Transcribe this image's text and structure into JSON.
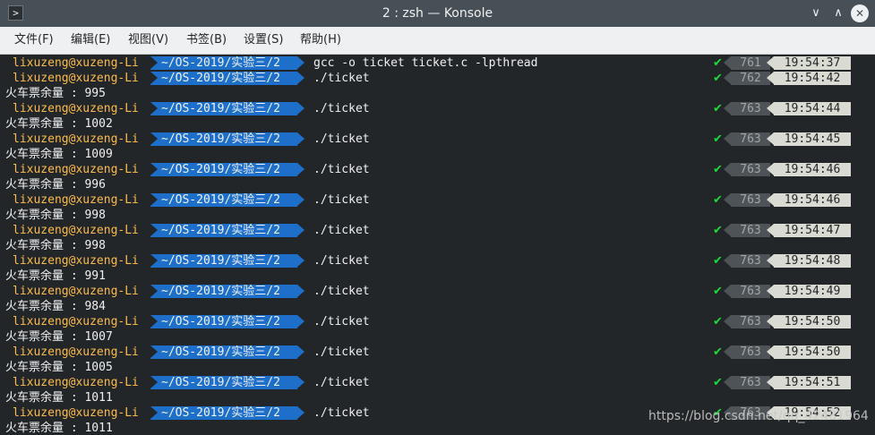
{
  "window": {
    "title": "2 : zsh — Konsole",
    "app_icon": "terminal-icon",
    "buttons": {
      "minimize": "∨",
      "maximize": "∧",
      "close": "✕"
    }
  },
  "menu": [
    {
      "label": "文件(F)"
    },
    {
      "label": "编辑(E)"
    },
    {
      "label": "视图(V)"
    },
    {
      "label": "书签(B)"
    },
    {
      "label": "设置(S)"
    },
    {
      "label": "帮助(H)"
    }
  ],
  "colors": {
    "user": "#fdbc4b",
    "path_segment": "#1d6fca",
    "success_check": "#1cdc3c",
    "history_segment": "#4d5357",
    "time_segment": "#d9dbd2",
    "terminal_bg": "#232629"
  },
  "terminal": {
    "user_host": "lixuzeng@xuzeng-Li",
    "path": "~/OS-2019/实验三/2",
    "status_icon": "✔",
    "prompts": [
      {
        "cmd": "gcc -o ticket ticket.c -lpthread",
        "hist": "761",
        "time": "19:54:37",
        "output": ""
      },
      {
        "cmd": "./ticket",
        "hist": "762",
        "time": "19:54:42",
        "output": "火车票余量 : 995"
      },
      {
        "cmd": "./ticket",
        "hist": "763",
        "time": "19:54:44",
        "output": "火车票余量 : 1002"
      },
      {
        "cmd": "./ticket",
        "hist": "763",
        "time": "19:54:45",
        "output": "火车票余量 : 1009"
      },
      {
        "cmd": "./ticket",
        "hist": "763",
        "time": "19:54:46",
        "output": "火车票余量 : 996"
      },
      {
        "cmd": "./ticket",
        "hist": "763",
        "time": "19:54:46",
        "output": "火车票余量 : 998"
      },
      {
        "cmd": "./ticket",
        "hist": "763",
        "time": "19:54:47",
        "output": "火车票余量 : 998"
      },
      {
        "cmd": "./ticket",
        "hist": "763",
        "time": "19:54:48",
        "output": "火车票余量 : 991"
      },
      {
        "cmd": "./ticket",
        "hist": "763",
        "time": "19:54:49",
        "output": "火车票余量 : 984"
      },
      {
        "cmd": "./ticket",
        "hist": "763",
        "time": "19:54:50",
        "output": "火车票余量 : 1007"
      },
      {
        "cmd": "./ticket",
        "hist": "763",
        "time": "19:54:50",
        "output": "火车票余量 : 1005"
      },
      {
        "cmd": "./ticket",
        "hist": "763",
        "time": "19:54:51",
        "output": "火车票余量 : 1011"
      },
      {
        "cmd": "./ticket",
        "hist": "763",
        "time": "19:54:52",
        "output": "火车票余量 : 1011"
      }
    ]
  },
  "watermark": "https://blog.csdn.net/qq_42481964"
}
